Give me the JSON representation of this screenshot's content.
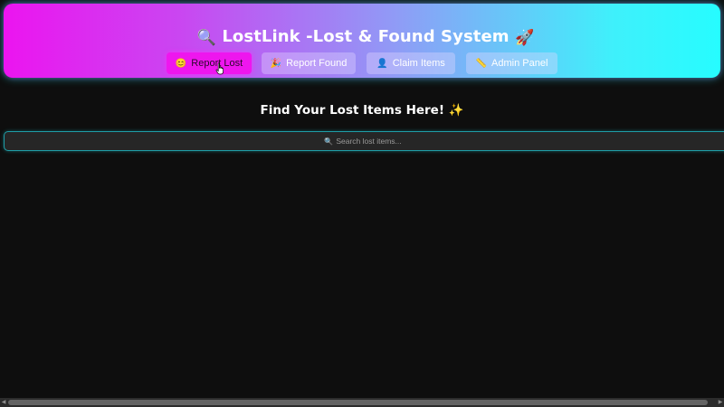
{
  "header": {
    "title_icon": "🔍",
    "title": "LostLink -Lost & Found System",
    "title_suffix_icon": "🚀"
  },
  "nav": {
    "items": [
      {
        "icon": "😊",
        "label": "Report Lost",
        "active": true
      },
      {
        "icon": "🎉",
        "label": "Report Found",
        "active": false
      },
      {
        "icon": "👤",
        "label": "Claim Items",
        "active": false
      },
      {
        "icon": "📏",
        "label": "Admin Panel",
        "active": false
      }
    ]
  },
  "main": {
    "section_title": "Find Your Lost Items Here!",
    "section_title_icon": "✨",
    "search": {
      "icon": "🔍",
      "placeholder": "Search lost items..."
    }
  },
  "colors": {
    "background": "#0e0e0e",
    "header_gradient_start": "#ec14f0",
    "header_gradient_end": "#26fcff",
    "active_button": "#ee16ee",
    "search_border": "#1f9ea8"
  }
}
